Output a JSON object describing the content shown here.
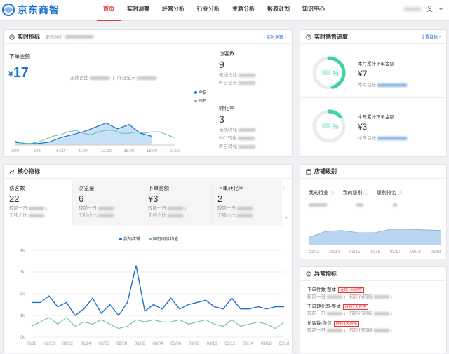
{
  "brand": {
    "name": "京东商智"
  },
  "nav": [
    "首页",
    "实时洞察",
    "经营分析",
    "行业分析",
    "主题分析",
    "报表计划",
    "知识中心"
  ],
  "realtime": {
    "title": "实时指标",
    "update_label": "更新时间",
    "link": "实时洞察",
    "gmv_label": "下单金额",
    "gmv_currency": "¥",
    "gmv_value": "17",
    "wireless_label": "无线占比",
    "yesterday_label": "昨日全天",
    "legend_today": "今日",
    "legend_yesterday": "昨日",
    "visitors": {
      "label": "访客数",
      "value": "9",
      "r1": "无线占比",
      "r2": "昨日全天"
    },
    "conversion": {
      "label": "转化率",
      "value": "3",
      "r1": "无线转化",
      "r2": "P C 转化",
      "r3": "昨日转化"
    }
  },
  "progress": {
    "title": "实时销售进度",
    "link": "设置目标",
    "month": {
      "label": "本月累计下单金额",
      "value": "¥7",
      "target_label": "本月目标",
      "pct": "%",
      "fraction": 0.46
    },
    "year": {
      "label": "本年累计下单金额",
      "value": "¥3",
      "target_label": "本年目标",
      "pct": "%",
      "fraction": 0.14
    }
  },
  "core": {
    "title": "核心指标",
    "cols": [
      {
        "label": "访客数",
        "value": "22",
        "r1": "较前一日",
        "r2": "无线占比",
        "arrow": "↓"
      },
      {
        "label": "浏览量",
        "value": "6",
        "r1": "较前一日",
        "r2": "无线占比",
        "arrow": "↑"
      },
      {
        "label": "下单金额",
        "value": "¥3",
        "r1": "较前一日",
        "r2": "无线占比",
        "arrow": "↓"
      },
      {
        "label": "下单转化率",
        "value": "2",
        "r1": "较前一日",
        "r2": "无线占比",
        "arrow": "↓"
      }
    ],
    "legend_mine": "我的店铺",
    "legend_peer": "同行同级均值",
    "prev_icon": "chevron-left-icon",
    "next_icon": "chevron-right-icon"
  },
  "level": {
    "title": "店铺级别",
    "industry_label": "我的行业",
    "level_label": "我的级别",
    "rank_label": "级别排名"
  },
  "abnormal": {
    "title": "异常指标",
    "items": [
      {
        "name": "下单件数-整体",
        "badge": "连续1天异常",
        "r1": "较前一日",
        "r2": "较同行同级"
      },
      {
        "name": "下单转化率-整体",
        "badge": "连续1天异常",
        "r1": "较前一日",
        "r2": "较同行同级"
      },
      {
        "name": "访客数-微信",
        "badge": "连续1天异常",
        "r1": "较前一日",
        "r2": "较同行同级"
      }
    ]
  },
  "colors": {
    "accent": "#e4393c",
    "blue": "#1a6fd1",
    "teal": "#3dd3a6"
  },
  "chart_data": [
    {
      "type": "area",
      "x": [
        "0:00",
        "3:00",
        "6:00",
        "9:00",
        "12:00",
        "15:00",
        "18:00",
        "21:00"
      ],
      "series": [
        {
          "name": "今日",
          "values": [
            0.1,
            0.05,
            0.05,
            0.1,
            0.25,
            0.35,
            0.45,
            0.6,
            0.75,
            0.55,
            0.7,
            0.4,
            0.3
          ]
        },
        {
          "name": "昨日",
          "values": [
            0.15,
            0.05,
            0.05,
            0.1,
            0.2,
            0.3,
            0.35,
            0.45,
            0.5,
            0.4,
            0.35,
            0.45,
            0.5,
            0.5,
            0.4,
            0.4,
            0.45,
            0.4,
            0.45,
            0.45,
            0.35,
            0.25
          ]
        }
      ]
    },
    {
      "type": "line",
      "x": [
        "02/18",
        "02/20",
        "02/22",
        "02/24",
        "02/26",
        "02/28",
        "03/02",
        "03/04",
        "03/06",
        "03/08",
        "03/10",
        "03/12",
        "03/14",
        "03/16",
        "03/18"
      ],
      "ytick_suffix": "k",
      "series": [
        {
          "name": "我的店铺",
          "values": [
            1.6,
            1.6,
            1.9,
            1.4,
            1.6,
            1.0,
            1.3,
            1.8,
            1.1,
            1.5,
            1.0,
            1.6,
            3.3,
            1.2,
            1.5,
            1.3,
            1.8,
            1.3,
            1.5,
            1.6,
            1.7,
            1.4,
            1.3,
            1.8,
            1.3,
            1.3,
            1.4,
            1.3,
            1.4,
            1.4
          ]
        },
        {
          "name": "同行同级均值",
          "values": [
            0.5,
            0.7,
            0.9,
            0.6,
            0.9,
            0.5,
            0.7,
            0.6,
            0.8,
            0.6,
            0.4,
            0.5,
            0.8,
            0.7,
            0.8,
            0.7,
            0.7,
            0.8,
            0.6,
            0.7,
            0.8,
            0.6,
            0.5,
            0.8,
            0.5,
            0.6,
            0.7,
            0.6,
            0.4,
            0.7
          ]
        }
      ]
    },
    {
      "type": "area",
      "x": [
        "03/13",
        "03/14",
        "03/15",
        "03/16",
        "03/17",
        "03/18",
        "03/19"
      ],
      "series": [
        {
          "values": [
            0.3,
            0.55,
            0.6,
            0.5,
            0.5,
            0.65,
            0.65,
            0.62,
            0.6
          ]
        }
      ]
    }
  ]
}
